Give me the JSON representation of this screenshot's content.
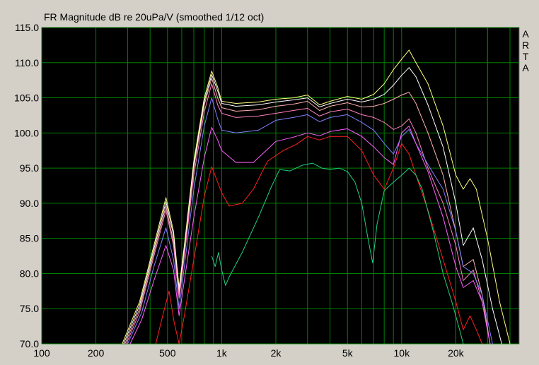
{
  "chart_data": {
    "type": "line",
    "title": "FR Magnitude dB re 20uPa/V (smoothed 1/12 oct)",
    "brand": [
      "A",
      "R",
      "T",
      "A"
    ],
    "xlabel": "",
    "ylabel": "",
    "x_scale": "log",
    "xlim": [
      100,
      45000
    ],
    "ylim": [
      70,
      115
    ],
    "grid": true,
    "x_ticks": [
      {
        "value": 100,
        "label": "100"
      },
      {
        "value": 200,
        "label": "200"
      },
      {
        "value": 500,
        "label": "500"
      },
      {
        "value": 1000,
        "label": "1k"
      },
      {
        "value": 2000,
        "label": "2k"
      },
      {
        "value": 5000,
        "label": "5k"
      },
      {
        "value": 10000,
        "label": "10k"
      },
      {
        "value": 20000,
        "label": "20k"
      }
    ],
    "y_ticks": [
      {
        "value": 115,
        "label": "115.0"
      },
      {
        "value": 110,
        "label": "110.0"
      },
      {
        "value": 105,
        "label": "105.0"
      },
      {
        "value": 100,
        "label": "100.0"
      },
      {
        "value": 95,
        "label": "95.0"
      },
      {
        "value": 90,
        "label": "90.0"
      },
      {
        "value": 85,
        "label": "85.0"
      },
      {
        "value": 80,
        "label": "80.0"
      },
      {
        "value": 75,
        "label": "75.0"
      },
      {
        "value": 70,
        "label": "70.0"
      }
    ],
    "series": [
      {
        "color": "#ffff80",
        "points": [
          [
            280,
            70
          ],
          [
            350,
            76
          ],
          [
            420,
            84
          ],
          [
            490,
            90.8
          ],
          [
            540,
            86
          ],
          [
            580,
            78
          ],
          [
            620,
            84
          ],
          [
            700,
            96
          ],
          [
            800,
            105
          ],
          [
            880,
            108.8
          ],
          [
            950,
            106.5
          ],
          [
            1000,
            104.5
          ],
          [
            1200,
            104.2
          ],
          [
            1600,
            104.4
          ],
          [
            2000,
            104.8
          ],
          [
            2500,
            105
          ],
          [
            3000,
            105.4
          ],
          [
            3500,
            104
          ],
          [
            4000,
            104.5
          ],
          [
            5000,
            105.2
          ],
          [
            6000,
            104.8
          ],
          [
            7000,
            105.5
          ],
          [
            8000,
            107
          ],
          [
            9000,
            109
          ],
          [
            10000,
            110.5
          ],
          [
            11000,
            111.8
          ],
          [
            12000,
            110
          ],
          [
            14000,
            107
          ],
          [
            17000,
            101
          ],
          [
            20000,
            94
          ],
          [
            22000,
            92
          ],
          [
            24000,
            93.5
          ],
          [
            26000,
            92
          ],
          [
            30000,
            85
          ],
          [
            35000,
            76
          ],
          [
            40000,
            70
          ]
        ]
      },
      {
        "color": "#ffffff",
        "points": [
          [
            285,
            70
          ],
          [
            350,
            75.5
          ],
          [
            420,
            83.5
          ],
          [
            490,
            90.2
          ],
          [
            540,
            85.5
          ],
          [
            580,
            77.5
          ],
          [
            620,
            83.5
          ],
          [
            700,
            95.5
          ],
          [
            800,
            104.5
          ],
          [
            880,
            108.3
          ],
          [
            950,
            106
          ],
          [
            1000,
            104.2
          ],
          [
            1200,
            103.8
          ],
          [
            1600,
            104
          ],
          [
            2000,
            104.4
          ],
          [
            2500,
            104.7
          ],
          [
            3000,
            105
          ],
          [
            3500,
            103.7
          ],
          [
            4000,
            104.2
          ],
          [
            5000,
            104.8
          ],
          [
            6000,
            104.4
          ],
          [
            7000,
            104.8
          ],
          [
            8000,
            105.5
          ],
          [
            9000,
            106.8
          ],
          [
            10000,
            108.2
          ],
          [
            11000,
            109.3
          ],
          [
            12000,
            108
          ],
          [
            14000,
            104
          ],
          [
            17000,
            98
          ],
          [
            20000,
            90
          ],
          [
            22000,
            84
          ],
          [
            25000,
            86.5
          ],
          [
            28000,
            82
          ],
          [
            32000,
            75
          ],
          [
            36000,
            70
          ]
        ]
      },
      {
        "color": "#ffb0b0",
        "points": [
          [
            290,
            70
          ],
          [
            350,
            75
          ],
          [
            420,
            83
          ],
          [
            490,
            89.6
          ],
          [
            540,
            84.5
          ],
          [
            580,
            77
          ],
          [
            620,
            83
          ],
          [
            700,
            95
          ],
          [
            800,
            104
          ],
          [
            880,
            107.8
          ],
          [
            950,
            105
          ],
          [
            1000,
            103.6
          ],
          [
            1200,
            103.1
          ],
          [
            1600,
            103.3
          ],
          [
            2000,
            103.8
          ],
          [
            2500,
            104.1
          ],
          [
            3000,
            104.5
          ],
          [
            3500,
            103.2
          ],
          [
            4000,
            103.8
          ],
          [
            5000,
            104.3
          ],
          [
            6000,
            103.7
          ],
          [
            7000,
            103.8
          ],
          [
            8000,
            104.2
          ],
          [
            9000,
            104.8
          ],
          [
            10000,
            105.4
          ],
          [
            11000,
            105.8
          ],
          [
            12000,
            104.2
          ],
          [
            14000,
            100
          ],
          [
            17000,
            94
          ],
          [
            20000,
            86
          ],
          [
            22000,
            81
          ],
          [
            25000,
            82
          ],
          [
            28000,
            77
          ],
          [
            31000,
            70
          ]
        ]
      },
      {
        "color": "#ff80c0",
        "points": [
          [
            295,
            70
          ],
          [
            350,
            74.5
          ],
          [
            420,
            82.5
          ],
          [
            490,
            89
          ],
          [
            540,
            84
          ],
          [
            580,
            76.5
          ],
          [
            620,
            82.5
          ],
          [
            700,
            94
          ],
          [
            800,
            103
          ],
          [
            880,
            107
          ],
          [
            950,
            104
          ],
          [
            1000,
            102.8
          ],
          [
            1200,
            102.2
          ],
          [
            1600,
            102.4
          ],
          [
            2000,
            102.8
          ],
          [
            2500,
            103.2
          ],
          [
            3000,
            103.5
          ],
          [
            3500,
            102.4
          ],
          [
            4000,
            103
          ],
          [
            5000,
            103.4
          ],
          [
            6000,
            102.6
          ],
          [
            7000,
            102.2
          ],
          [
            8000,
            101.5
          ],
          [
            9000,
            100.5
          ],
          [
            10000,
            101
          ],
          [
            11000,
            102
          ],
          [
            12000,
            100
          ],
          [
            14000,
            95
          ],
          [
            17000,
            90
          ],
          [
            20000,
            84
          ],
          [
            22000,
            79
          ],
          [
            25000,
            80.5
          ],
          [
            28000,
            76
          ],
          [
            31000,
            70
          ]
        ]
      },
      {
        "color": "#8080ff",
        "points": [
          [
            300,
            70
          ],
          [
            360,
            74.5
          ],
          [
            420,
            81
          ],
          [
            490,
            86.5
          ],
          [
            540,
            82
          ],
          [
            580,
            75
          ],
          [
            620,
            81
          ],
          [
            700,
            92
          ],
          [
            800,
            101
          ],
          [
            880,
            105
          ],
          [
            950,
            102
          ],
          [
            1000,
            100.4
          ],
          [
            1200,
            100
          ],
          [
            1600,
            100.4
          ],
          [
            2000,
            101.8
          ],
          [
            2500,
            102.2
          ],
          [
            3000,
            102.6
          ],
          [
            3500,
            101.6
          ],
          [
            4000,
            102.2
          ],
          [
            5000,
            102.6
          ],
          [
            6000,
            101.5
          ],
          [
            7000,
            100.4
          ],
          [
            8000,
            98.5
          ],
          [
            9000,
            97
          ],
          [
            10000,
            99.5
          ],
          [
            11000,
            100.5
          ],
          [
            12000,
            98.5
          ],
          [
            14000,
            95.5
          ],
          [
            17000,
            92
          ],
          [
            20000,
            86
          ],
          [
            22000,
            81
          ],
          [
            25000,
            80
          ],
          [
            28000,
            77
          ],
          [
            32000,
            70
          ]
        ]
      },
      {
        "color": "#ff60ff",
        "points": [
          [
            310,
            70
          ],
          [
            360,
            73.5
          ],
          [
            420,
            79
          ],
          [
            490,
            84
          ],
          [
            540,
            80.5
          ],
          [
            580,
            74
          ],
          [
            620,
            79
          ],
          [
            700,
            88
          ],
          [
            800,
            96.5
          ],
          [
            880,
            100.8
          ],
          [
            950,
            99
          ],
          [
            1000,
            97.5
          ],
          [
            1200,
            95.8
          ],
          [
            1500,
            95.8
          ],
          [
            2000,
            98.8
          ],
          [
            2500,
            99.4
          ],
          [
            3000,
            100
          ],
          [
            3500,
            99.6
          ],
          [
            4000,
            100.2
          ],
          [
            5000,
            100.6
          ],
          [
            6000,
            99.5
          ],
          [
            7000,
            98
          ],
          [
            8000,
            96.5
          ],
          [
            9000,
            95.5
          ],
          [
            10000,
            100
          ],
          [
            11000,
            101
          ],
          [
            12000,
            98.5
          ],
          [
            14000,
            94.5
          ],
          [
            17000,
            88
          ],
          [
            20000,
            81
          ],
          [
            22000,
            78
          ],
          [
            25000,
            79
          ],
          [
            28000,
            76
          ],
          [
            31000,
            70
          ]
        ]
      },
      {
        "color": "#ff2020",
        "points": [
          [
            430,
            70
          ],
          [
            470,
            74
          ],
          [
            510,
            77.5
          ],
          [
            545,
            73
          ],
          [
            580,
            70
          ],
          [
            620,
            74
          ],
          [
            700,
            82
          ],
          [
            800,
            91
          ],
          [
            880,
            95.2
          ],
          [
            950,
            93
          ],
          [
            1000,
            91.5
          ],
          [
            1100,
            89.6
          ],
          [
            1300,
            90
          ],
          [
            1500,
            92
          ],
          [
            1800,
            96
          ],
          [
            2200,
            97.5
          ],
          [
            2600,
            98.4
          ],
          [
            3000,
            99.5
          ],
          [
            3500,
            99
          ],
          [
            4000,
            99.5
          ],
          [
            5000,
            99.5
          ],
          [
            6000,
            97.5
          ],
          [
            7000,
            94
          ],
          [
            8000,
            92
          ],
          [
            9000,
            95
          ],
          [
            10000,
            98.5
          ],
          [
            11000,
            97
          ],
          [
            12000,
            94
          ],
          [
            14000,
            89
          ],
          [
            17000,
            82
          ],
          [
            20000,
            76
          ],
          [
            22000,
            72
          ],
          [
            24000,
            74
          ],
          [
            26000,
            72
          ],
          [
            28000,
            70
          ]
        ]
      },
      {
        "color": "#20d080",
        "points": [
          [
            880,
            82.5
          ],
          [
            920,
            81
          ],
          [
            960,
            83
          ],
          [
            1000,
            80.5
          ],
          [
            1050,
            78.3
          ],
          [
            1100,
            79.5
          ],
          [
            1300,
            83
          ],
          [
            1600,
            88
          ],
          [
            1900,
            92.5
          ],
          [
            2100,
            94.8
          ],
          [
            2400,
            94.6
          ],
          [
            2800,
            95.4
          ],
          [
            3200,
            95.7
          ],
          [
            3600,
            95
          ],
          [
            4000,
            94.8
          ],
          [
            4500,
            95
          ],
          [
            5000,
            94.5
          ],
          [
            5500,
            93
          ],
          [
            6000,
            90
          ],
          [
            6500,
            85
          ],
          [
            6900,
            81.5
          ],
          [
            7300,
            87
          ],
          [
            8000,
            91.8
          ],
          [
            9000,
            93
          ],
          [
            10000,
            94
          ],
          [
            11000,
            95
          ],
          [
            12000,
            94
          ],
          [
            13000,
            92
          ],
          [
            15000,
            86
          ],
          [
            17000,
            80
          ],
          [
            19000,
            76
          ],
          [
            21000,
            72
          ],
          [
            22000,
            70
          ]
        ]
      }
    ]
  }
}
